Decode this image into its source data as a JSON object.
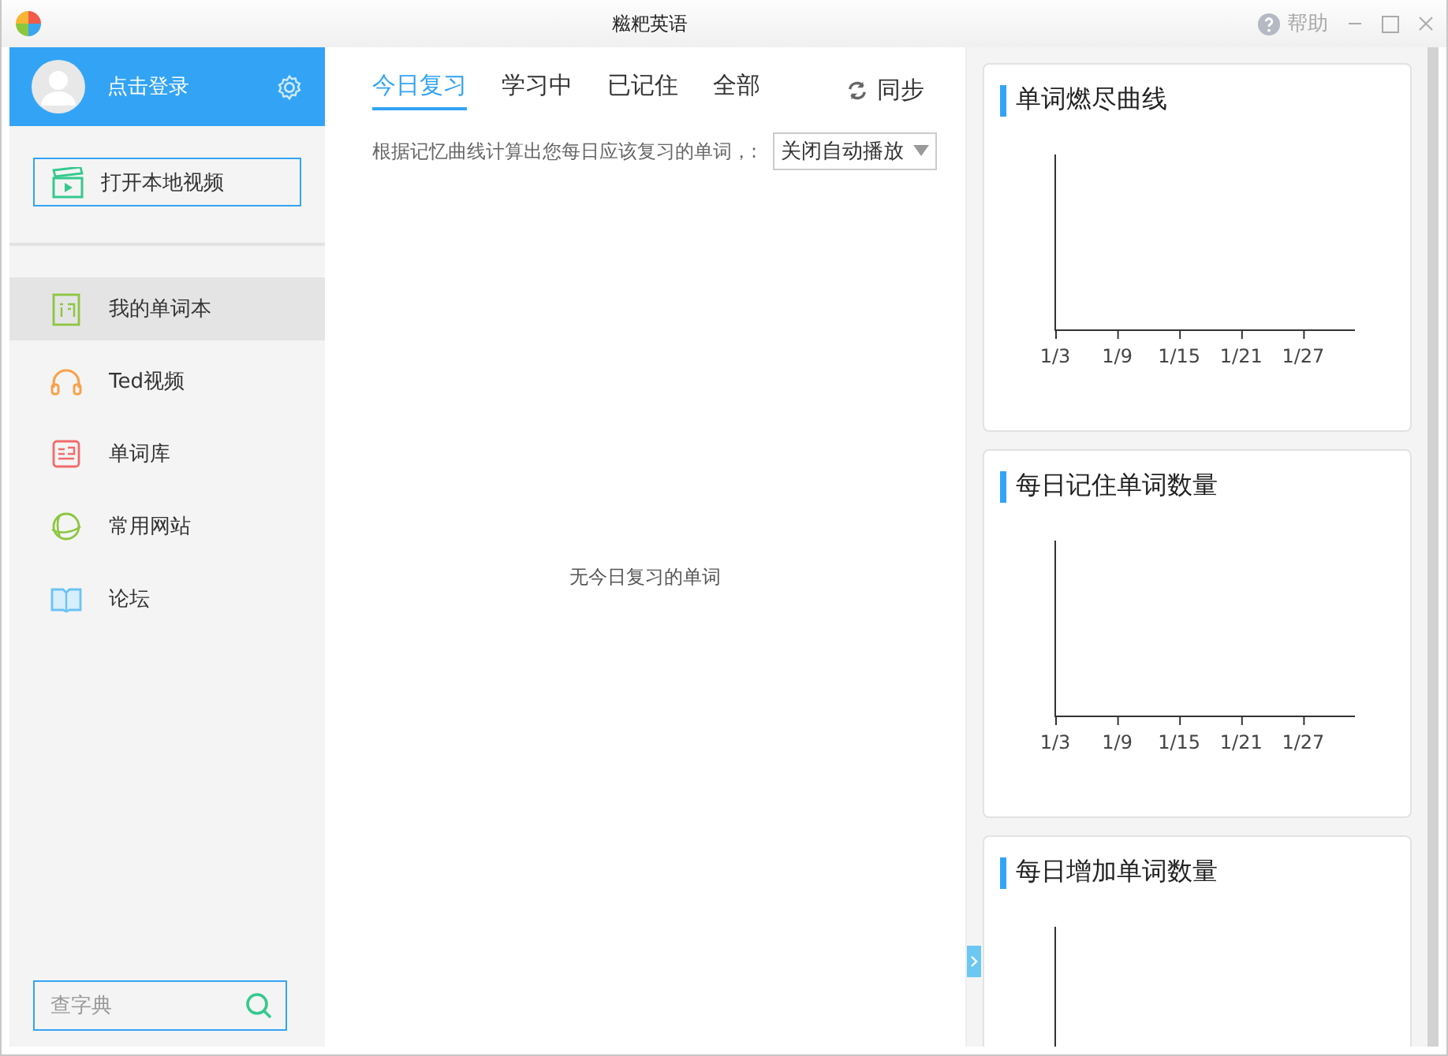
{
  "window": {
    "title": "糍粑英语",
    "help": "帮助"
  },
  "user": {
    "login": "点击登录"
  },
  "open_video": "打开本地视频",
  "sidebar": {
    "items": [
      {
        "label": "我的单词本",
        "selected": true
      },
      {
        "label": "Ted视频",
        "selected": false
      },
      {
        "label": "单词库",
        "selected": false
      },
      {
        "label": "常用网站",
        "selected": false
      },
      {
        "label": "论坛",
        "selected": false
      }
    ]
  },
  "dictionary_search": {
    "placeholder": "查字典"
  },
  "tabs": [
    {
      "label": "今日复习",
      "selected": true
    },
    {
      "label": "学习中",
      "selected": false
    },
    {
      "label": "已记住",
      "selected": false
    },
    {
      "label": "全部",
      "selected": false
    }
  ],
  "sync": "同步",
  "description": "根据记忆曲线计算出您每日应该复习的单词，:",
  "autoplay": {
    "value": "关闭自动播放"
  },
  "empty_message": "无今日复习的单词",
  "charts": [
    {
      "title": "单词燃尽曲线",
      "axis_labels": [
        "1/3",
        "1/9",
        "1/15",
        "1/21",
        "1/27"
      ]
    },
    {
      "title": "每日记住单词数量",
      "axis_labels": [
        "1/3",
        "1/9",
        "1/15",
        "1/21",
        "1/27"
      ]
    },
    {
      "title": "每日增加单词数量"
    }
  ]
}
